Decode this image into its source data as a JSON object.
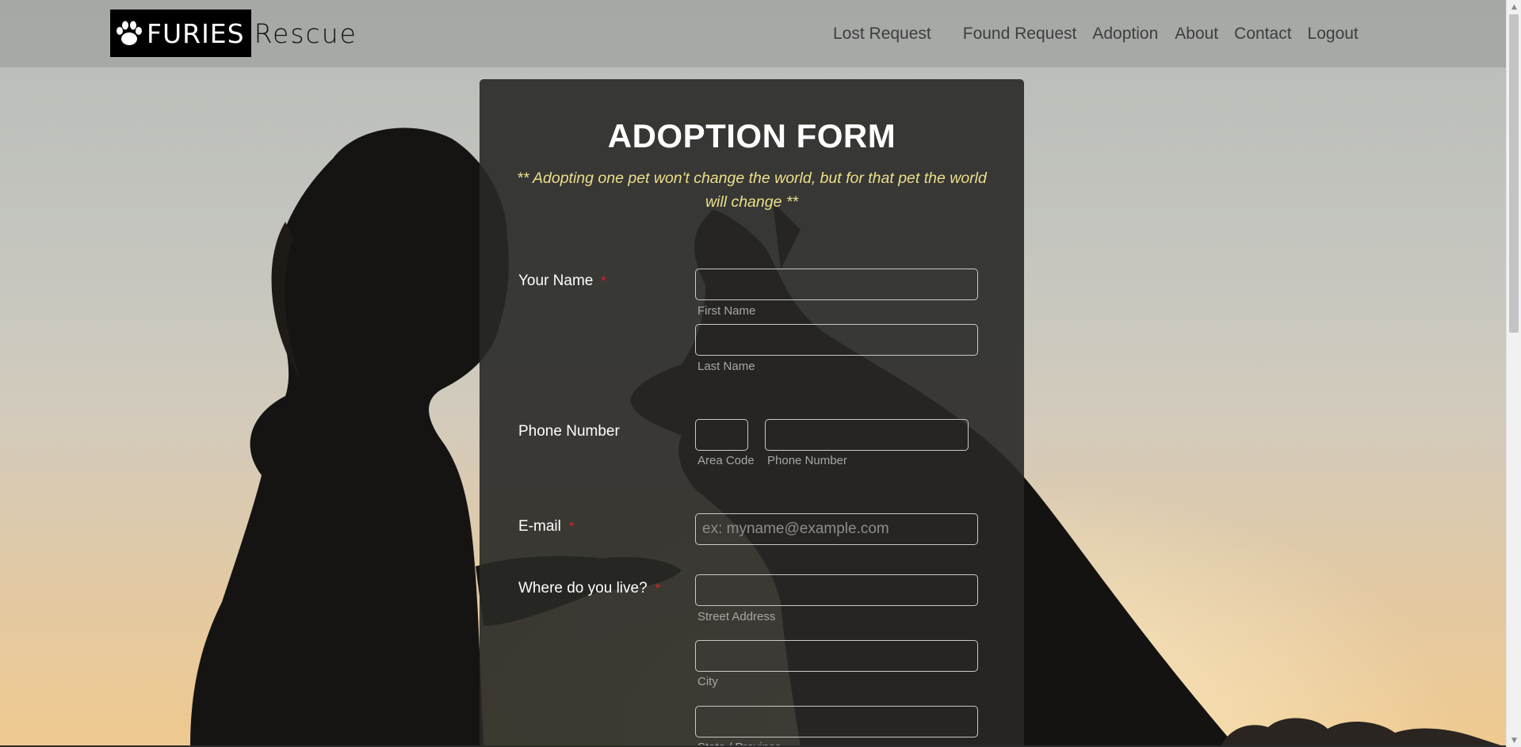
{
  "brand": {
    "name_part1": "FURIES",
    "name_part2": "Rescue"
  },
  "nav": {
    "items": [
      {
        "label": "Lost Request"
      },
      {
        "label": "Found Request"
      },
      {
        "label": "Adoption"
      },
      {
        "label": "About"
      },
      {
        "label": "Contact"
      },
      {
        "label": "Logout"
      }
    ]
  },
  "form": {
    "title": "ADOPTION FORM",
    "quote": "** Adopting one pet won't change the world, but for that pet the world will change **",
    "required_marker": "*",
    "name": {
      "label": "Your Name",
      "first_sub": "First Name",
      "last_sub": "Last Name",
      "first_value": "",
      "last_value": ""
    },
    "phone": {
      "label": "Phone Number",
      "area_sub": "Area Code",
      "number_sub": "Phone Number",
      "area_value": "",
      "number_value": ""
    },
    "email": {
      "label": "E-mail",
      "placeholder": "ex: myname@example.com",
      "value": ""
    },
    "address": {
      "label": "Where do you live?",
      "street_sub": "Street Address",
      "city_sub": "City",
      "state_sub": "State / Province"
    }
  }
}
